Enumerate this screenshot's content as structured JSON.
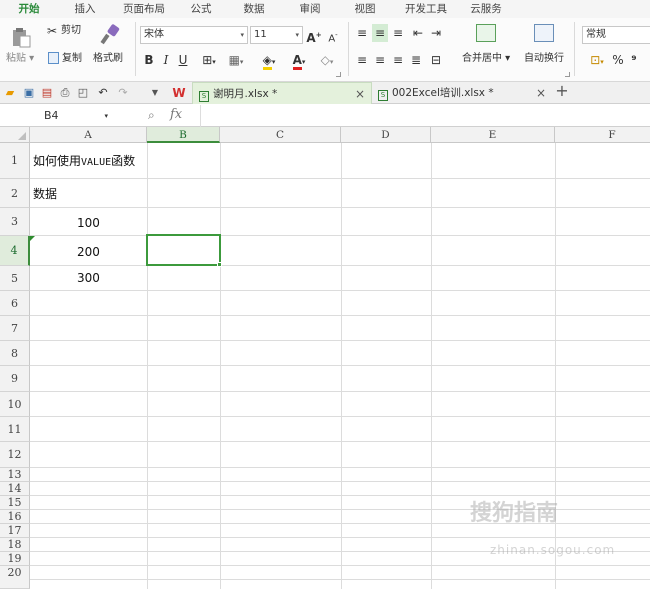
{
  "menu_tabs": [
    "开始",
    "插入",
    "页面布局",
    "公式",
    "数据",
    "审阅",
    "视图",
    "开发工具",
    "云服务"
  ],
  "ribbon": {
    "paste_label": "粘贴",
    "cut_label": "剪切",
    "copy_label": "复制",
    "format_painter_label": "格式刷",
    "font_name": "宋体",
    "font_size": "11",
    "bold": "B",
    "italic": "I",
    "underline": "U",
    "merge_center_label": "合并居中",
    "wrap_text_label": "自动换行",
    "number_format": "常规",
    "percent": "%",
    "comma": "⁹"
  },
  "tabs": [
    {
      "name": "谢明月.xlsx *",
      "active": true
    },
    {
      "name": "002Excel培训.xlsx *",
      "active": false
    }
  ],
  "formula_bar": {
    "cell_ref": "B4",
    "fx": "fx",
    "value": ""
  },
  "columns": [
    "A",
    "B",
    "C",
    "D",
    "E",
    "F"
  ],
  "rows": [
    "1",
    "2",
    "3",
    "4",
    "5",
    "6",
    "7",
    "8",
    "9",
    "10",
    "11",
    "12",
    "13",
    "14",
    "15",
    "16",
    "17",
    "18",
    "19",
    "20"
  ],
  "cells": {
    "A1_cn_before": "如何使用",
    "A1_latin": "VALUE",
    "A1_cn_after": "函数",
    "A2": "数据",
    "A3": "100",
    "A4": "200",
    "A5": "300"
  },
  "selected_cell": "B4",
  "accent_color": "#3c9a3c",
  "watermark": {
    "main": "搜狗指南",
    "sub": "zhinan.sogou.com"
  }
}
